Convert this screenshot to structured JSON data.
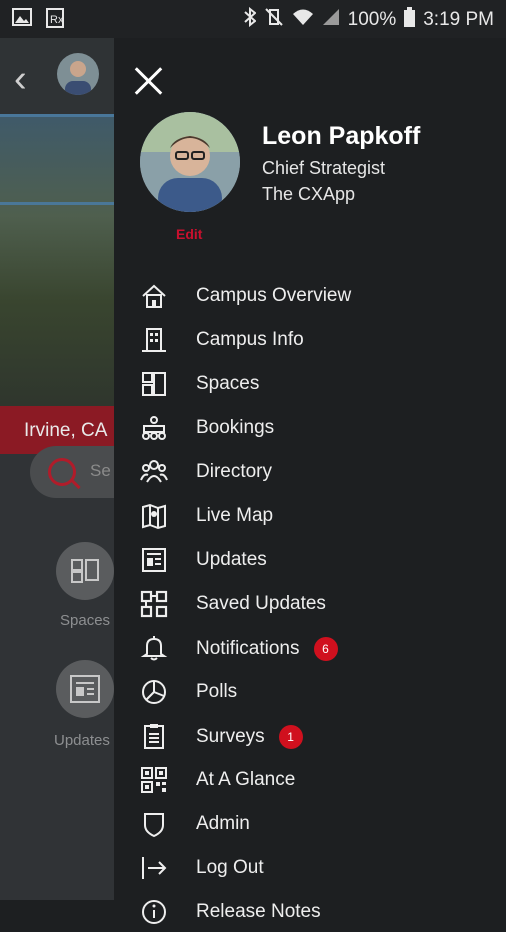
{
  "status_bar": {
    "battery": "100%",
    "time": "3:19 PM",
    "icons": [
      "image-icon",
      "prescription-icon",
      "bluetooth-icon",
      "vibrate-icon",
      "wifi-icon",
      "signal-icon",
      "battery-icon"
    ]
  },
  "background": {
    "city": "Irvine, CA",
    "search_placeholder": "Se",
    "tiles": [
      {
        "label": "Spaces",
        "icon": "spaces-icon"
      },
      {
        "label": "Updates",
        "icon": "updates-icon"
      }
    ]
  },
  "profile": {
    "name": "Leon Papkoff",
    "title": "Chief Strategist",
    "company": "The CXApp",
    "edit_label": "Edit"
  },
  "menu": {
    "items": [
      {
        "label": "Campus Overview",
        "icon": "home-icon"
      },
      {
        "label": "Campus Info",
        "icon": "building-icon"
      },
      {
        "label": "Spaces",
        "icon": "spaces-icon"
      },
      {
        "label": "Bookings",
        "icon": "bookings-icon"
      },
      {
        "label": "Directory",
        "icon": "people-icon"
      },
      {
        "label": "Live Map",
        "icon": "map-icon"
      },
      {
        "label": "Updates",
        "icon": "newspaper-icon"
      },
      {
        "label": "Saved Updates",
        "icon": "saved-updates-icon"
      },
      {
        "label": "Notifications",
        "icon": "bell-icon",
        "badge": "6"
      },
      {
        "label": "Polls",
        "icon": "pie-chart-icon"
      },
      {
        "label": "Surveys",
        "icon": "clipboard-icon",
        "badge": "1"
      },
      {
        "label": "At A Glance",
        "icon": "qr-code-icon"
      },
      {
        "label": "Admin",
        "icon": "shield-icon"
      },
      {
        "label": "Log Out",
        "icon": "logout-icon"
      },
      {
        "label": "Release Notes",
        "icon": "info-icon"
      }
    ]
  },
  "colors": {
    "accent": "#c8102e",
    "drawer_bg": "#1d1f21",
    "badge": "#d0101e"
  }
}
